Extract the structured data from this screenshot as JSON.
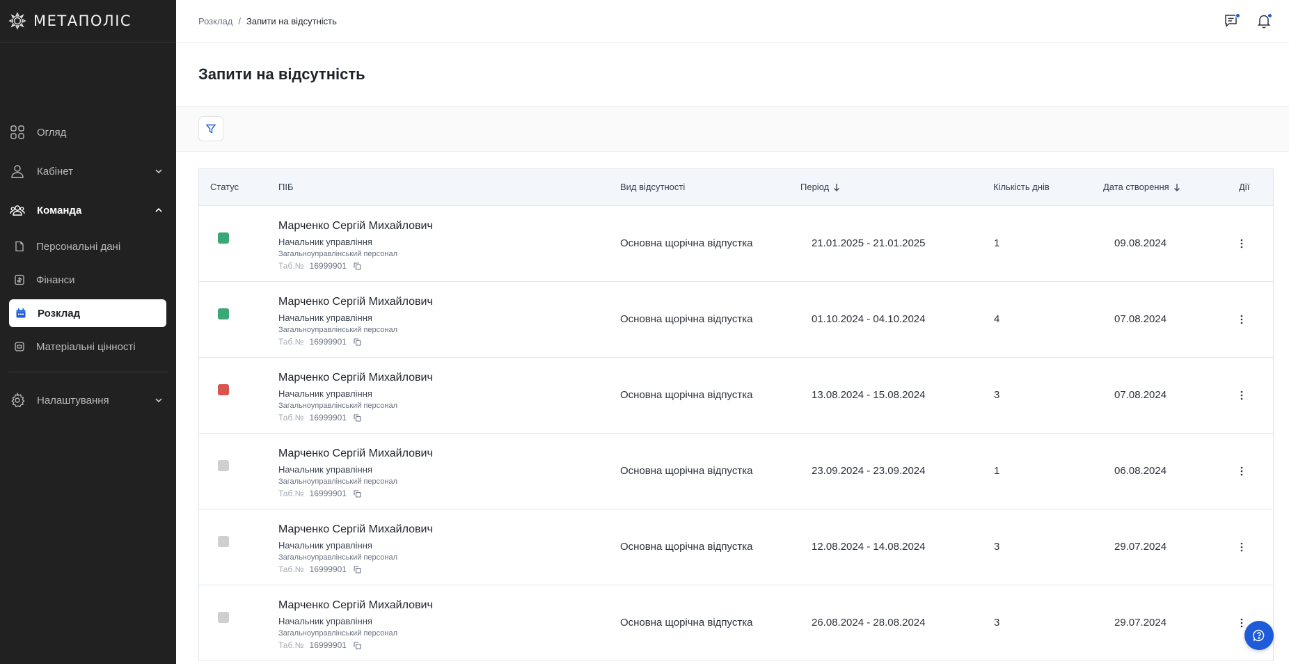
{
  "app": {
    "logo_text": "МЕТАПОЛІС"
  },
  "sidebar": {
    "items": [
      {
        "label": "Огляд",
        "icon": "grid-icon"
      },
      {
        "label": "Кабінет",
        "icon": "user-icon"
      },
      {
        "label": "Команда",
        "icon": "team-icon"
      }
    ],
    "sub_items": [
      {
        "label": "Персональні дані",
        "icon": "document-icon"
      },
      {
        "label": "Фінанси",
        "icon": "finance-icon"
      },
      {
        "label": "Розклад",
        "icon": "calendar-icon"
      },
      {
        "label": "Матеріальні цінності",
        "icon": "assets-icon"
      }
    ],
    "settings": {
      "label": "Налаштування",
      "icon": "gear-icon"
    }
  },
  "breadcrumb": {
    "parent": "Розклад",
    "separator": "/",
    "current": "Запити на відсутність"
  },
  "page": {
    "title": "Запити на відсутність"
  },
  "table": {
    "headers": {
      "status": "Статус",
      "name": "ПІБ",
      "absence_type": "Вид відсутності",
      "period": "Період",
      "days": "Кількість днів",
      "created": "Дата створення",
      "actions": "Дії"
    },
    "tab_label": "Таб.№",
    "rows": [
      {
        "status": "approved",
        "status_color": "#3aa876",
        "name": "Марченко Сергій Михайлович",
        "position": "Начальник управління",
        "category": "Загальноуправлінський персонал",
        "tab_number": "16999901",
        "absence_type": "Основна щорічна відпустка",
        "period": "21.01.2025 - 21.01.2025",
        "days": "1",
        "created": "09.08.2024"
      },
      {
        "status": "approved",
        "status_color": "#3aa876",
        "name": "Марченко Сергій Михайлович",
        "position": "Начальник управління",
        "category": "Загальноуправлінський персонал",
        "tab_number": "16999901",
        "absence_type": "Основна щорічна відпустка",
        "period": "01.10.2024 - 04.10.2024",
        "days": "4",
        "created": "07.08.2024"
      },
      {
        "status": "rejected",
        "status_color": "#d9534f",
        "name": "Марченко Сергій Михайлович",
        "position": "Начальник управління",
        "category": "Загальноуправлінський персонал",
        "tab_number": "16999901",
        "absence_type": "Основна щорічна відпустка",
        "period": "13.08.2024 - 15.08.2024",
        "days": "3",
        "created": "07.08.2024"
      },
      {
        "status": "pending",
        "status_color": "#cfcfcf",
        "name": "Марченко Сергій Михайлович",
        "position": "Начальник управління",
        "category": "Загальноуправлінський персонал",
        "tab_number": "16999901",
        "absence_type": "Основна щорічна відпустка",
        "period": "23.09.2024 - 23.09.2024",
        "days": "1",
        "created": "06.08.2024"
      },
      {
        "status": "pending",
        "status_color": "#cfcfcf",
        "name": "Марченко Сергій Михайлович",
        "position": "Начальник управління",
        "category": "Загальноуправлінський персонал",
        "tab_number": "16999901",
        "absence_type": "Основна щорічна відпустка",
        "period": "12.08.2024 - 14.08.2024",
        "days": "3",
        "created": "29.07.2024"
      },
      {
        "status": "pending",
        "status_color": "#cfcfcf",
        "name": "Марченко Сергій Михайлович",
        "position": "Начальник управління",
        "category": "Загальноуправлінський персонал",
        "tab_number": "16999901",
        "absence_type": "Основна щорічна відпустка",
        "period": "26.08.2024 - 28.08.2024",
        "days": "3",
        "created": "29.07.2024"
      }
    ]
  },
  "colors": {
    "sidebar_bg": "#212121",
    "accent": "#1e5bd8",
    "approved": "#3aa876",
    "rejected": "#d9534f",
    "pending": "#cfcfcf"
  }
}
